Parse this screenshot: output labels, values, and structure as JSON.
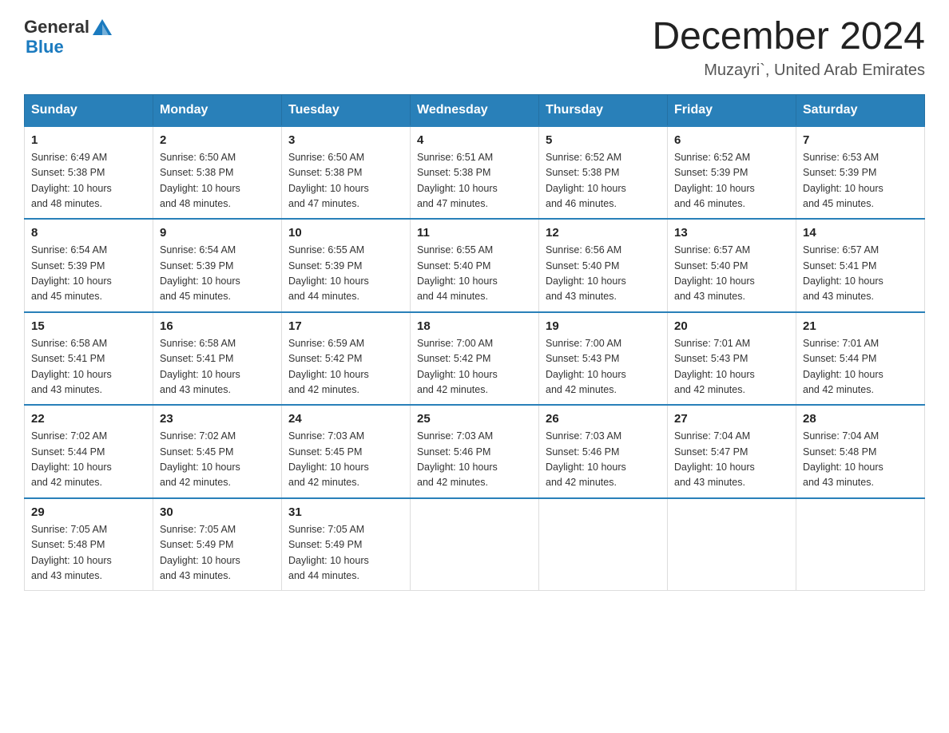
{
  "header": {
    "logo_general": "General",
    "logo_blue": "Blue",
    "title": "December 2024",
    "subtitle": "Muzayri`, United Arab Emirates"
  },
  "days_of_week": [
    "Sunday",
    "Monday",
    "Tuesday",
    "Wednesday",
    "Thursday",
    "Friday",
    "Saturday"
  ],
  "weeks": [
    [
      {
        "day": "1",
        "sunrise": "6:49 AM",
        "sunset": "5:38 PM",
        "daylight": "10 hours and 48 minutes."
      },
      {
        "day": "2",
        "sunrise": "6:50 AM",
        "sunset": "5:38 PM",
        "daylight": "10 hours and 48 minutes."
      },
      {
        "day": "3",
        "sunrise": "6:50 AM",
        "sunset": "5:38 PM",
        "daylight": "10 hours and 47 minutes."
      },
      {
        "day": "4",
        "sunrise": "6:51 AM",
        "sunset": "5:38 PM",
        "daylight": "10 hours and 47 minutes."
      },
      {
        "day": "5",
        "sunrise": "6:52 AM",
        "sunset": "5:38 PM",
        "daylight": "10 hours and 46 minutes."
      },
      {
        "day": "6",
        "sunrise": "6:52 AM",
        "sunset": "5:39 PM",
        "daylight": "10 hours and 46 minutes."
      },
      {
        "day": "7",
        "sunrise": "6:53 AM",
        "sunset": "5:39 PM",
        "daylight": "10 hours and 45 minutes."
      }
    ],
    [
      {
        "day": "8",
        "sunrise": "6:54 AM",
        "sunset": "5:39 PM",
        "daylight": "10 hours and 45 minutes."
      },
      {
        "day": "9",
        "sunrise": "6:54 AM",
        "sunset": "5:39 PM",
        "daylight": "10 hours and 45 minutes."
      },
      {
        "day": "10",
        "sunrise": "6:55 AM",
        "sunset": "5:39 PM",
        "daylight": "10 hours and 44 minutes."
      },
      {
        "day": "11",
        "sunrise": "6:55 AM",
        "sunset": "5:40 PM",
        "daylight": "10 hours and 44 minutes."
      },
      {
        "day": "12",
        "sunrise": "6:56 AM",
        "sunset": "5:40 PM",
        "daylight": "10 hours and 43 minutes."
      },
      {
        "day": "13",
        "sunrise": "6:57 AM",
        "sunset": "5:40 PM",
        "daylight": "10 hours and 43 minutes."
      },
      {
        "day": "14",
        "sunrise": "6:57 AM",
        "sunset": "5:41 PM",
        "daylight": "10 hours and 43 minutes."
      }
    ],
    [
      {
        "day": "15",
        "sunrise": "6:58 AM",
        "sunset": "5:41 PM",
        "daylight": "10 hours and 43 minutes."
      },
      {
        "day": "16",
        "sunrise": "6:58 AM",
        "sunset": "5:41 PM",
        "daylight": "10 hours and 43 minutes."
      },
      {
        "day": "17",
        "sunrise": "6:59 AM",
        "sunset": "5:42 PM",
        "daylight": "10 hours and 42 minutes."
      },
      {
        "day": "18",
        "sunrise": "7:00 AM",
        "sunset": "5:42 PM",
        "daylight": "10 hours and 42 minutes."
      },
      {
        "day": "19",
        "sunrise": "7:00 AM",
        "sunset": "5:43 PM",
        "daylight": "10 hours and 42 minutes."
      },
      {
        "day": "20",
        "sunrise": "7:01 AM",
        "sunset": "5:43 PM",
        "daylight": "10 hours and 42 minutes."
      },
      {
        "day": "21",
        "sunrise": "7:01 AM",
        "sunset": "5:44 PM",
        "daylight": "10 hours and 42 minutes."
      }
    ],
    [
      {
        "day": "22",
        "sunrise": "7:02 AM",
        "sunset": "5:44 PM",
        "daylight": "10 hours and 42 minutes."
      },
      {
        "day": "23",
        "sunrise": "7:02 AM",
        "sunset": "5:45 PM",
        "daylight": "10 hours and 42 minutes."
      },
      {
        "day": "24",
        "sunrise": "7:03 AM",
        "sunset": "5:45 PM",
        "daylight": "10 hours and 42 minutes."
      },
      {
        "day": "25",
        "sunrise": "7:03 AM",
        "sunset": "5:46 PM",
        "daylight": "10 hours and 42 minutes."
      },
      {
        "day": "26",
        "sunrise": "7:03 AM",
        "sunset": "5:46 PM",
        "daylight": "10 hours and 42 minutes."
      },
      {
        "day": "27",
        "sunrise": "7:04 AM",
        "sunset": "5:47 PM",
        "daylight": "10 hours and 43 minutes."
      },
      {
        "day": "28",
        "sunrise": "7:04 AM",
        "sunset": "5:48 PM",
        "daylight": "10 hours and 43 minutes."
      }
    ],
    [
      {
        "day": "29",
        "sunrise": "7:05 AM",
        "sunset": "5:48 PM",
        "daylight": "10 hours and 43 minutes."
      },
      {
        "day": "30",
        "sunrise": "7:05 AM",
        "sunset": "5:49 PM",
        "daylight": "10 hours and 43 minutes."
      },
      {
        "day": "31",
        "sunrise": "7:05 AM",
        "sunset": "5:49 PM",
        "daylight": "10 hours and 44 minutes."
      },
      null,
      null,
      null,
      null
    ]
  ],
  "labels": {
    "sunrise": "Sunrise:",
    "sunset": "Sunset:",
    "daylight": "Daylight:"
  }
}
